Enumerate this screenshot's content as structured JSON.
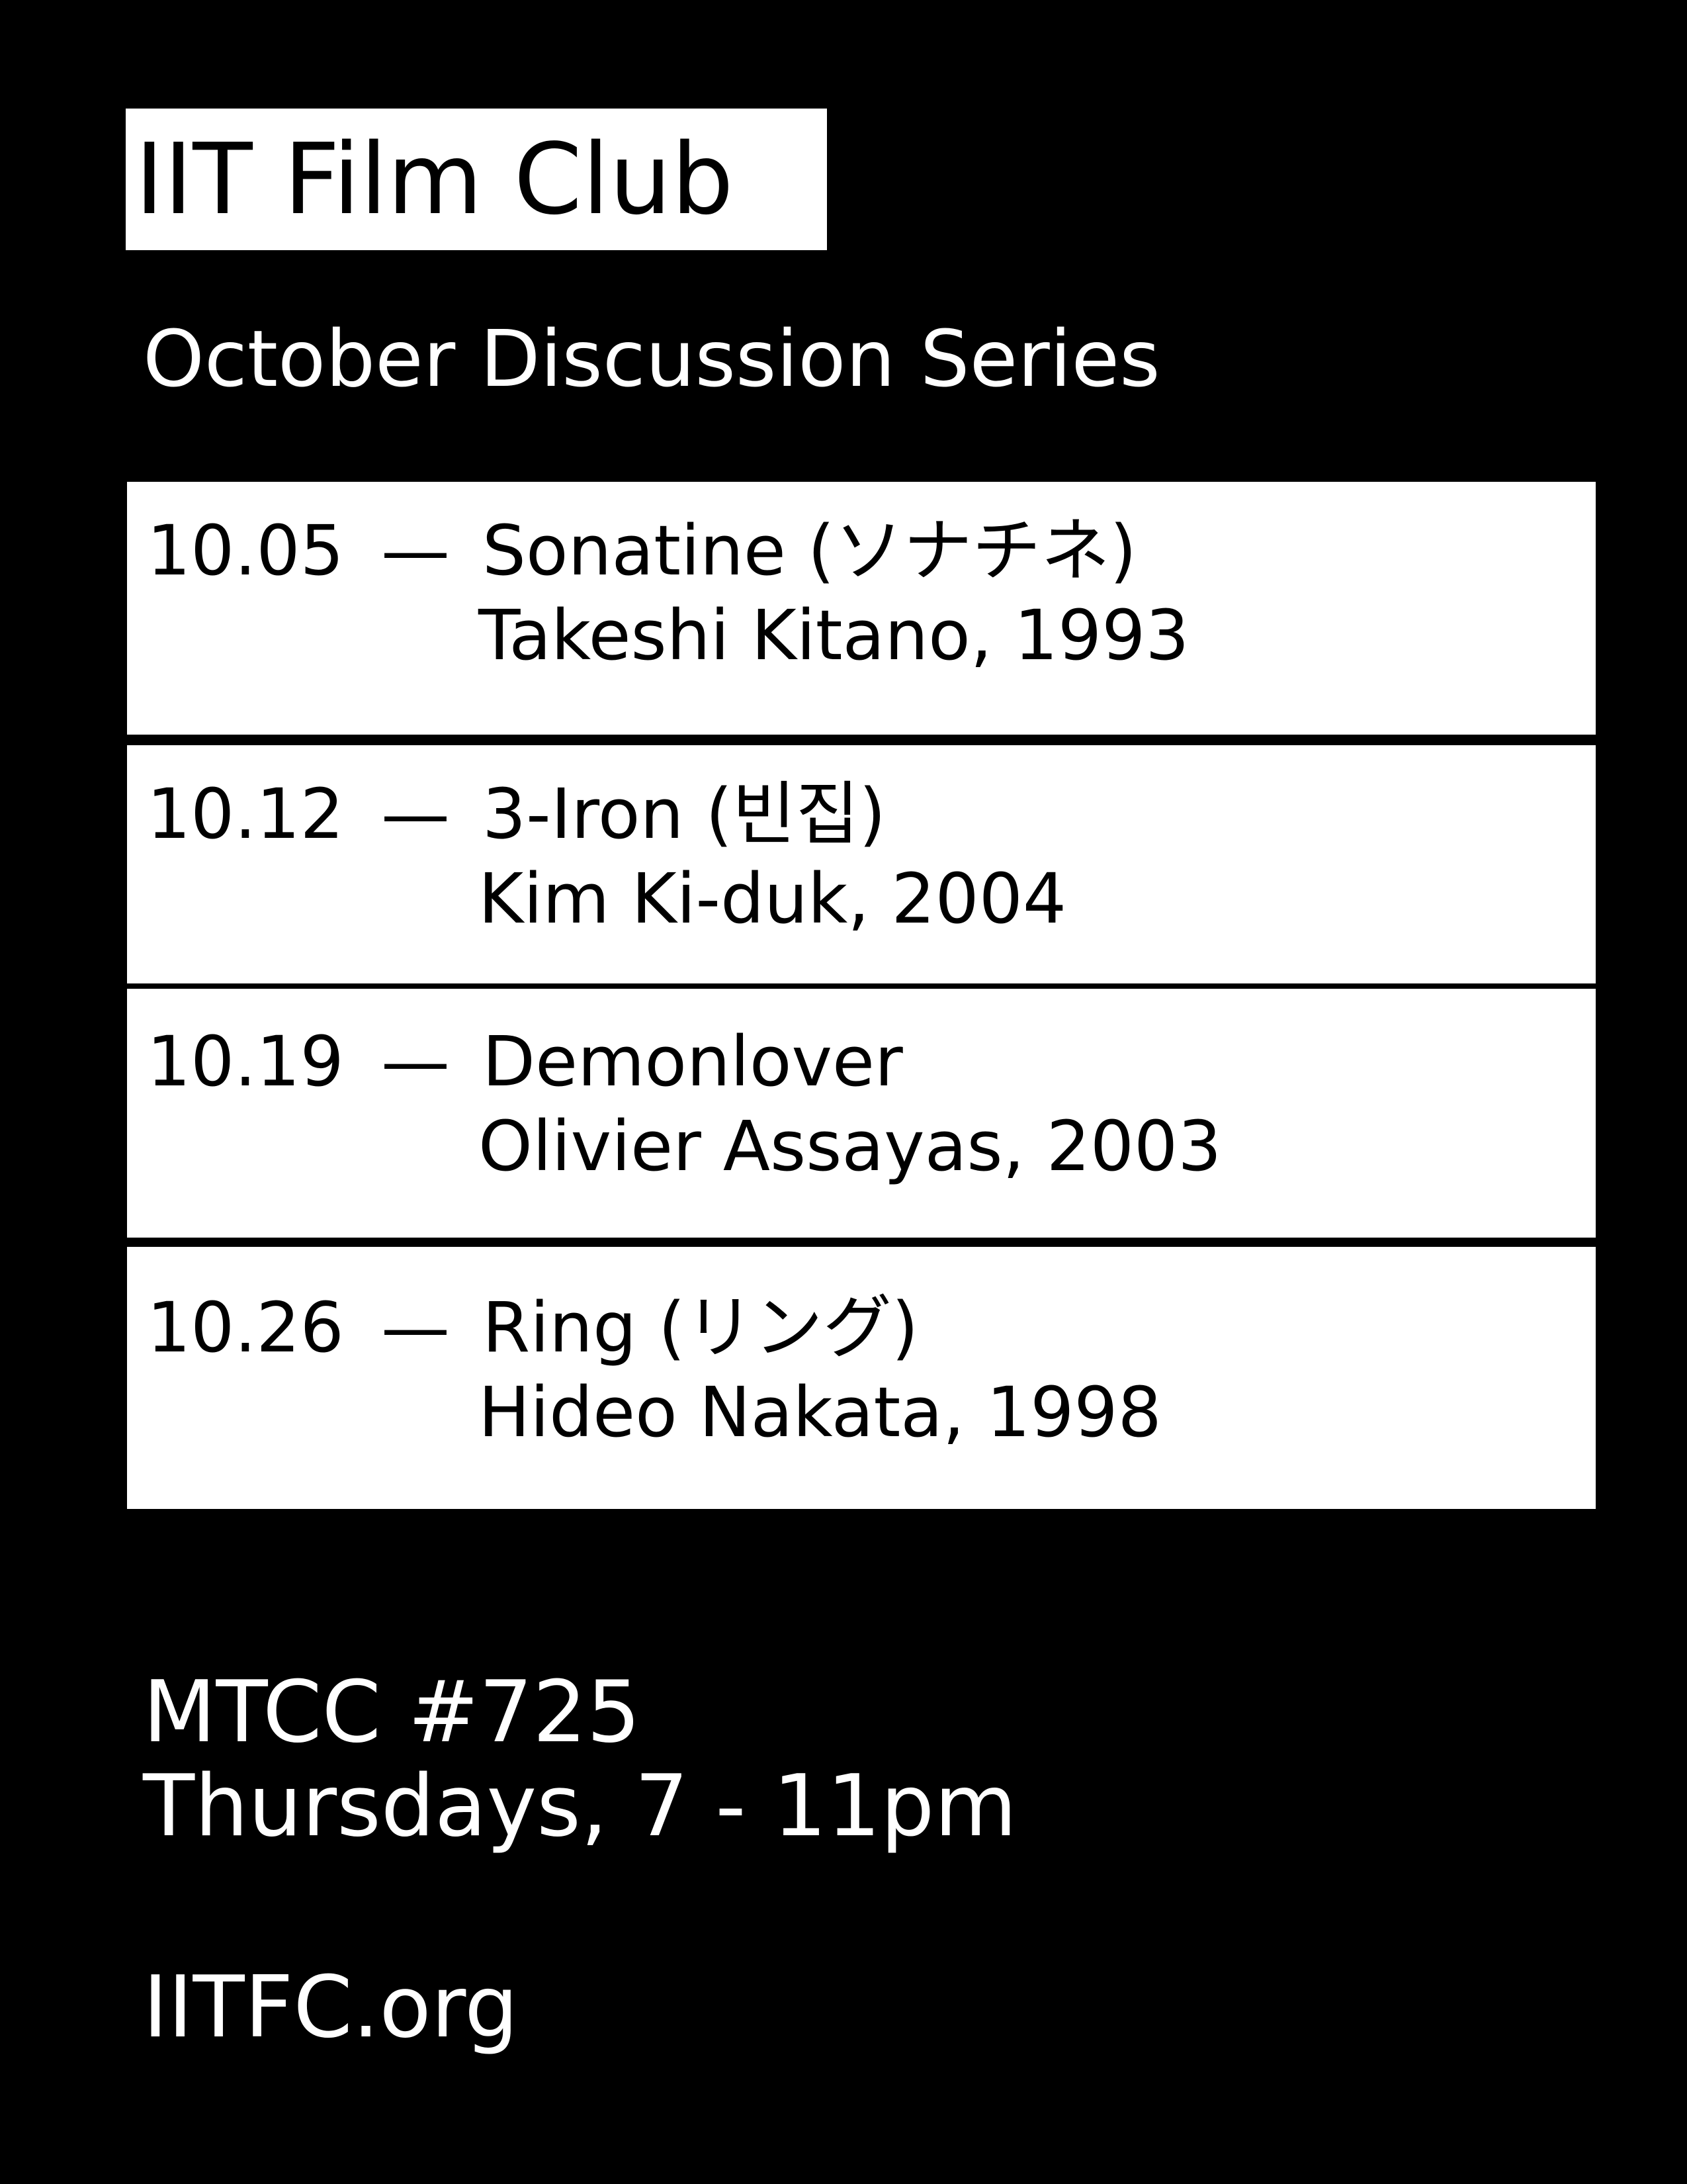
{
  "header": {
    "title": "IIT Film Club",
    "subtitle": "October Discussion Series"
  },
  "schedule": [
    {
      "date": "10.05",
      "dash": "—",
      "title": "Sonatine (ソナチネ)",
      "credit": "Takeshi Kitano, 1993"
    },
    {
      "date": "10.12",
      "dash": "—",
      "title": "3-Iron (빈집)",
      "credit": "Kim Ki-duk, 2004"
    },
    {
      "date": "10.19",
      "dash": "—",
      "title": "Demonlover",
      "credit": "Olivier Assayas, 2003"
    },
    {
      "date": "10.26",
      "dash": "—",
      "title": "Ring (リング)",
      "credit": "Hideo Nakata, 1998"
    }
  ],
  "footer": {
    "location": "MTCC #725",
    "time": "Thursdays, 7 - 11pm",
    "website": "IITFC.org"
  },
  "colors": {
    "background": "#000000",
    "foreground": "#ffffff"
  }
}
